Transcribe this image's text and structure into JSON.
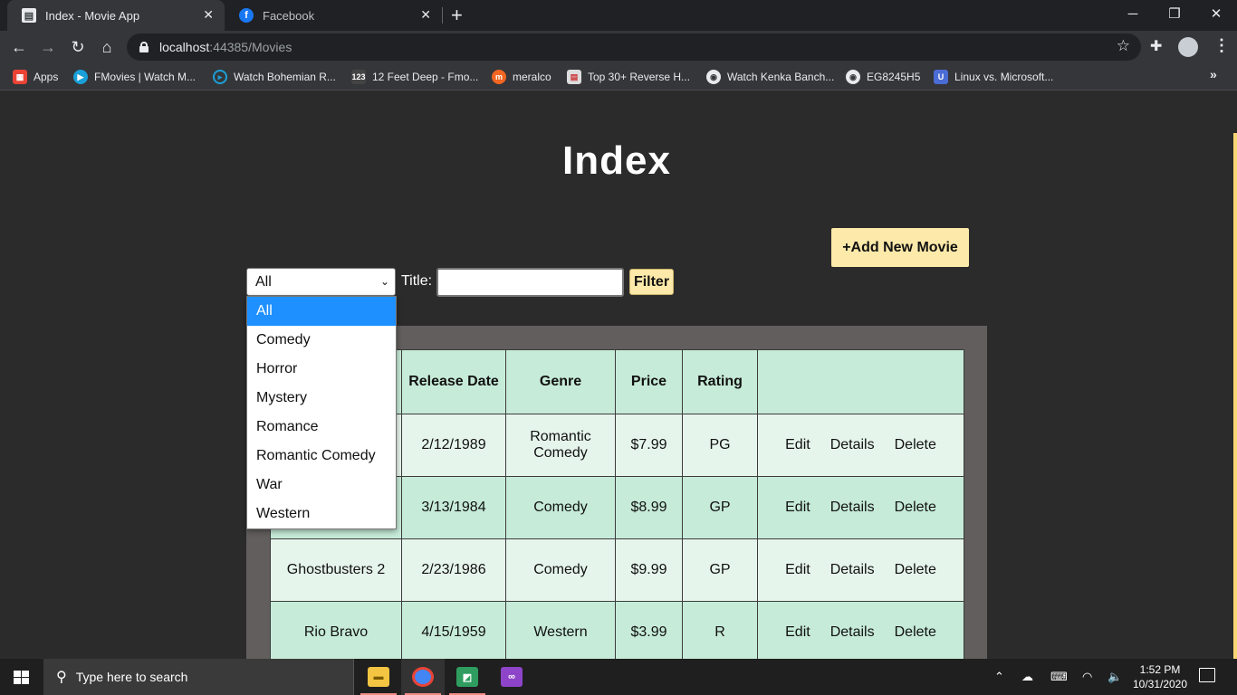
{
  "browser": {
    "tabs": [
      {
        "title": "Index - Movie App",
        "icon": "document-icon"
      },
      {
        "title": "Facebook",
        "icon": "facebook-icon"
      }
    ],
    "new_tab": "+",
    "url_host": "localhost",
    "url_rest": ":44385/Movies",
    "bookmarks": [
      {
        "label": "Apps",
        "icon": "apps-grid-icon",
        "color": "#ea4335"
      },
      {
        "label": "FMovies | Watch M...",
        "icon": "play-icon",
        "color": "#1aa0d8"
      },
      {
        "label": "Watch Bohemian R...",
        "icon": "play-circle-icon",
        "color": "#1aa0d8"
      },
      {
        "label": "12 Feet Deep - Fmo...",
        "icon": "site-123-icon",
        "color": "#444444"
      },
      {
        "label": "meralco",
        "icon": "meralco-icon",
        "color": "#f26522"
      },
      {
        "label": "Top 30+ Reverse H...",
        "icon": "article-icon",
        "color": "#dddddd"
      },
      {
        "label": "Watch Kenka Banch...",
        "icon": "globe-icon",
        "color": "#9aa0a6"
      },
      {
        "label": "EG8245H5",
        "icon": "globe-icon",
        "color": "#9aa0a6"
      },
      {
        "label": "Linux vs. Microsoft...",
        "icon": "shield-icon",
        "color": "#4a6cd4"
      }
    ],
    "more_bookmarks": "»"
  },
  "page": {
    "title": "Index",
    "add_button": "+Add New Movie",
    "filter": {
      "genre_selected": "All",
      "title_label": "Title:",
      "title_value": "",
      "filter_button": "Filter"
    },
    "genre_options": [
      "All",
      "Comedy",
      "Horror",
      "Mystery",
      "Romance",
      "Romantic Comedy",
      "War",
      "Western"
    ],
    "table": {
      "headers": [
        "",
        "Release Date",
        "Genre",
        "Price",
        "Rating",
        ""
      ],
      "rows": [
        {
          "title": "",
          "date": "2/12/1989",
          "genre": "Romantic Comedy",
          "price": "$7.99",
          "rating": "PG"
        },
        {
          "title": "",
          "date": "3/13/1984",
          "genre": "Comedy",
          "price": "$8.99",
          "rating": "GP"
        },
        {
          "title": "Ghostbusters 2",
          "date": "2/23/1986",
          "genre": "Comedy",
          "price": "$9.99",
          "rating": "GP"
        },
        {
          "title": "Rio Bravo",
          "date": "4/15/1959",
          "genre": "Western",
          "price": "$3.99",
          "rating": "R"
        }
      ],
      "actions": [
        "Edit",
        "Details",
        "Delete"
      ]
    }
  },
  "taskbar": {
    "search_placeholder": "Type here to search",
    "time": "1:52 PM",
    "date": "10/31/2020",
    "apps": [
      {
        "name": "file-explorer-icon",
        "color": "#f4c542"
      },
      {
        "name": "chrome-icon",
        "color": "#4285f4"
      },
      {
        "name": "azure-data-studio-icon",
        "color": "#2e9d5f"
      },
      {
        "name": "visual-studio-icon",
        "color": "#8e44c9"
      }
    ]
  },
  "colors": {
    "page_bg": "#2b2b2b",
    "accent_button": "#fde9a9",
    "table_header": "#c6ebd8",
    "table_row_light": "#e6f5ec",
    "dropdown_selected": "#1e90ff"
  }
}
